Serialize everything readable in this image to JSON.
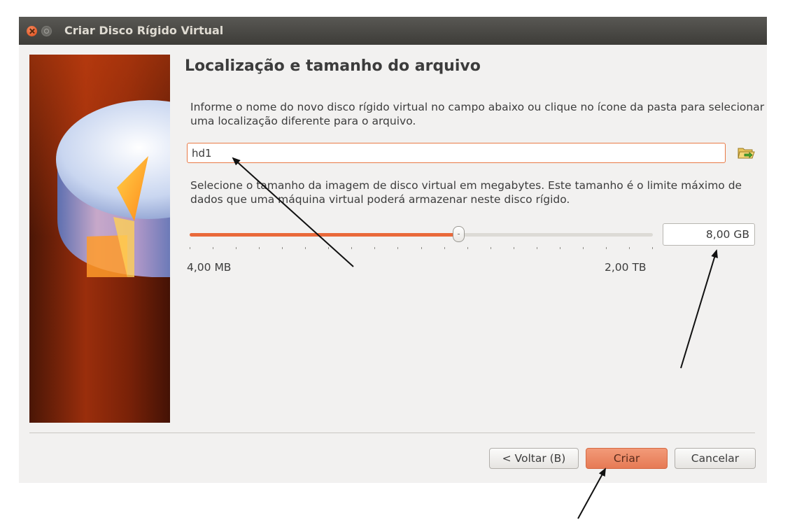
{
  "window": {
    "title": "Criar Disco Rígido Virtual"
  },
  "page": {
    "heading": "Localização e tamanho do arquivo",
    "location_description": "Informe o nome do novo disco rígido virtual no campo abaixo ou clique no ícone da pasta para selecionar uma localização diferente para o arquivo.",
    "file_name_value": "hd1",
    "size_description": "Selecione o tamanho da imagem de disco virtual em megabytes. Este tamanho é o limite máximo de dados que uma máquina virtual poderá armazenar neste disco rígido.",
    "size_value": "8,00 GB",
    "slider": {
      "min_label": "4,00 MB",
      "max_label": "2,00 TB",
      "position_fraction": 0.58
    }
  },
  "buttons": {
    "back_label": "< Voltar (B)",
    "create_label": "Criar",
    "cancel_label": "Cancelar"
  },
  "colors": {
    "accent": "#e9693a",
    "titlebar": "#3c3b37",
    "dialog_background": "#f2f1f0",
    "annotation_arrows": "#111111"
  },
  "icons": {
    "close": "close-icon",
    "minimize": "minimize-icon",
    "folder": "folder-open-icon",
    "side_image": "hard-disk-illustration"
  }
}
